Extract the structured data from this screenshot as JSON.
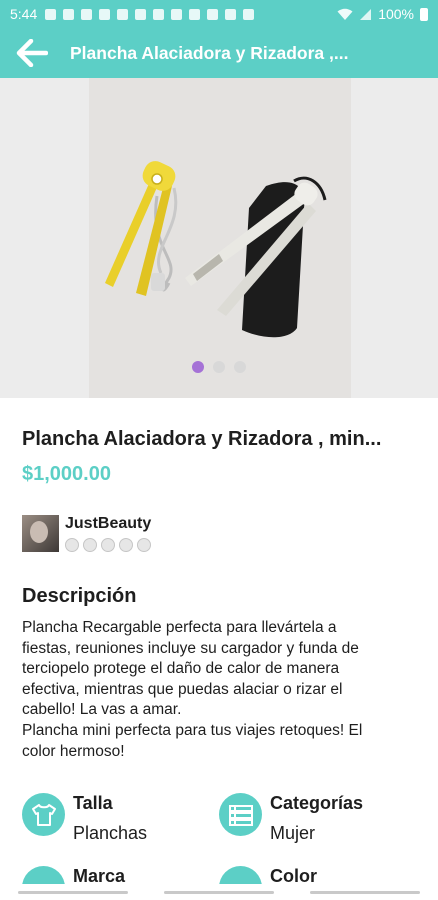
{
  "status_bar": {
    "time": "5:44",
    "battery": "100%"
  },
  "app_bar": {
    "title": "Plancha Alaciadora y Rizadora ,..."
  },
  "gallery": {
    "image_count": 3,
    "active_index": 0
  },
  "product": {
    "title": "Plancha Alaciadora y Rizadora , min...",
    "price": "$1,000.00"
  },
  "seller": {
    "name": "JustBeauty",
    "rating_slots": 5
  },
  "description": {
    "heading": "Descripción",
    "lines": [
      "Plancha Recargable perfecta para llevártela a",
      "fiestas, reuniones incluye su cargador y funda de",
      "terciopelo protege el daño de calor de manera",
      "efectiva, mientras que puedas alaciar o rizar el",
      "cabello! La vas a amar.",
      "Plancha mini perfecta para tus viajes retoques! El",
      "color hermoso!"
    ]
  },
  "attributes": {
    "talla": {
      "label": "Talla",
      "value": "Planchas",
      "icon": "tshirt-icon"
    },
    "categorias": {
      "label": "Categorías",
      "value": "Mujer",
      "icon": "list-icon"
    },
    "marca": {
      "label": "Marca",
      "icon": "tag-icon"
    },
    "color": {
      "label": "Color",
      "icon": "palette-icon"
    }
  },
  "colors": {
    "accent": "#5ccfc6",
    "dot_active": "#a572d6"
  }
}
